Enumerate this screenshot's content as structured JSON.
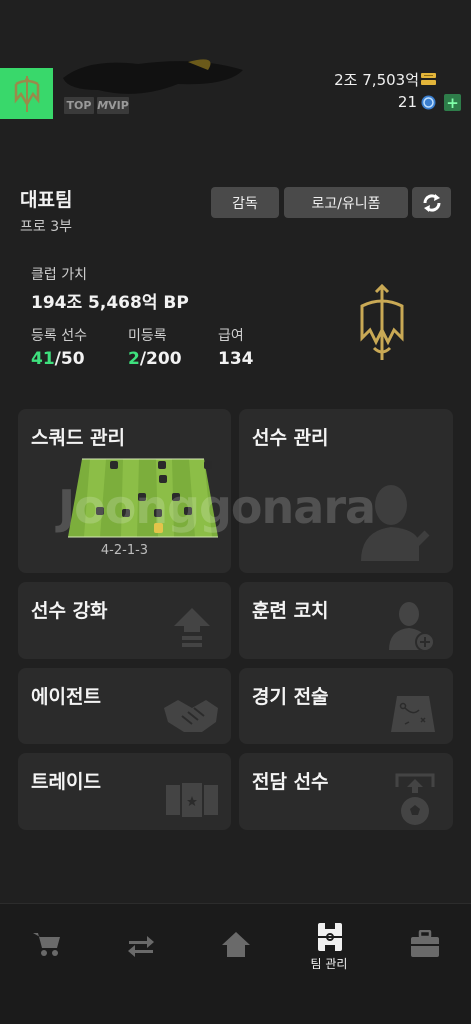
{
  "header": {
    "tags": {
      "top": "TOP",
      "vip": "VIP"
    },
    "currency": {
      "coins": "2조 7,503억",
      "mc": "21",
      "plus": "+"
    },
    "icons": [
      "team-logo-icon",
      "coin-icon",
      "mc-icon",
      "plus-icon"
    ],
    "accent_color": "#39d86b"
  },
  "team": {
    "name": "대표팀",
    "division": "프로 3부",
    "buttons": {
      "coach": "감독",
      "logo_uniform": "로고/유니폼"
    }
  },
  "stats": {
    "club_value_label": "클럽 가치",
    "club_value": "194조 5,468억 BP",
    "registered_label": "등록 선수",
    "registered_current": "41",
    "registered_max": "/50",
    "unregistered_label": "미등록",
    "unregistered_current": "2",
    "unregistered_max": "/200",
    "salary_label": "급여",
    "salary": "134"
  },
  "tiles": {
    "squad": {
      "title": "스쿼드 관리",
      "formation": "4-2-1-3"
    },
    "players": {
      "title": "선수 관리"
    },
    "enhance": {
      "title": "선수 강화"
    },
    "training": {
      "title": "훈련 코치"
    },
    "agent": {
      "title": "에이전트"
    },
    "tactics": {
      "title": "경기 전술"
    },
    "trade": {
      "title": "트레이드"
    },
    "dedicated": {
      "title": "전담 선수"
    }
  },
  "watermark": "Joonggonara",
  "nav": {
    "items": [
      "shop-icon",
      "transfer-icon",
      "home-icon",
      "team-manage-icon",
      "inventory-icon"
    ],
    "active_label": "팀 관리"
  }
}
